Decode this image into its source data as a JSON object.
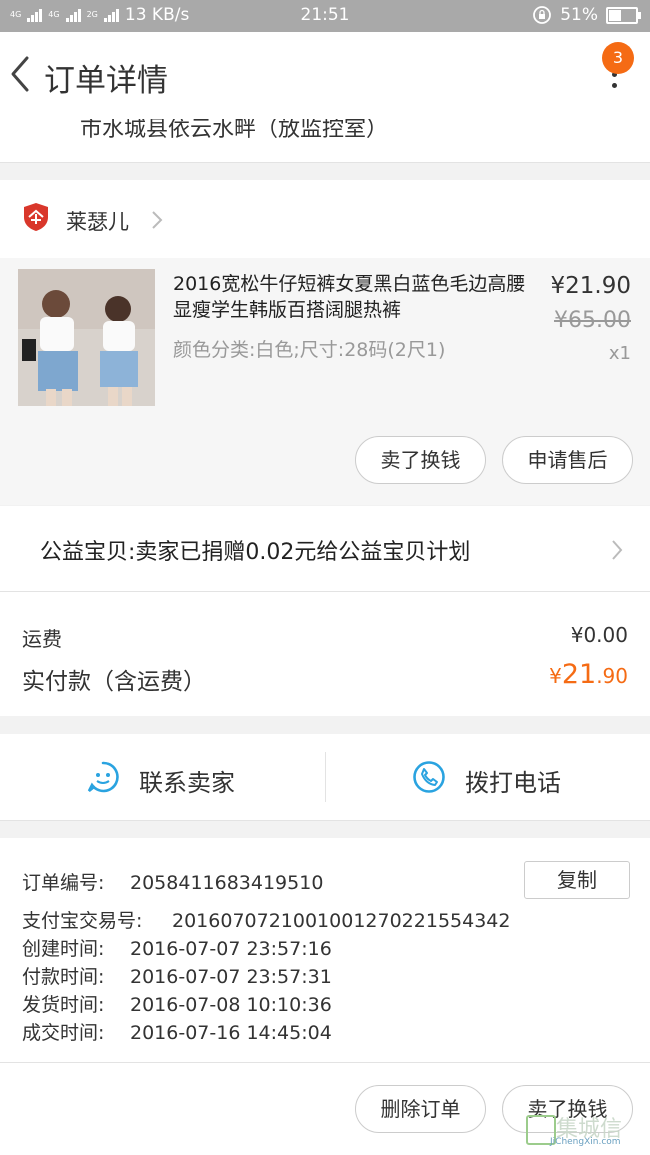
{
  "status_bar": {
    "network_left": "4G",
    "network_mid": "4G",
    "network_2g": "2G",
    "speed": "13 KB/s",
    "time": "21:51",
    "battery": "51%"
  },
  "header": {
    "title": "订单详情",
    "badge_count": "3"
  },
  "address_tail": "市水城县依云水畔（放监控室）",
  "seller": {
    "name": "莱瑟儿"
  },
  "item": {
    "title": "2016宽松牛仔短裤女夏黑白蓝色毛边高腰显瘦学生韩版百搭阔腿热裤",
    "sku": "颜色分类:白色;尺寸:28码(2尺1)",
    "price": "¥21.90",
    "original_price": "¥65.00",
    "quantity": "x1",
    "actions": [
      "卖了换钱",
      "申请售后"
    ]
  },
  "charity": {
    "text": "公益宝贝:卖家已捐赠0.02元给公益宝贝计划"
  },
  "fees": {
    "shipping_label": "运费",
    "shipping_value": "¥0.00",
    "paid_label": "实付款（含运费）",
    "paid_currency": "¥",
    "paid_integer": "21",
    "paid_decimal": ".90"
  },
  "contact": {
    "seller_label": "联系卖家",
    "phone_label": "拨打电话"
  },
  "order_info": {
    "copy_label": "复制",
    "rows": [
      {
        "key": "订单编号:",
        "value": "2058411683419510"
      },
      {
        "key": "支付宝交易号:",
        "value": "2016070721001001270221554342"
      },
      {
        "key": "创建时间:",
        "value": "2016-07-07 23:57:16"
      },
      {
        "key": "付款时间:",
        "value": "2016-07-07 23:57:31"
      },
      {
        "key": "发货时间:",
        "value": "2016-07-08 10:10:36"
      },
      {
        "key": "成交时间:",
        "value": "2016-07-16 14:45:04"
      }
    ]
  },
  "bottom_actions": [
    "删除订单",
    "卖了换钱"
  ],
  "watermark": {
    "text": "集城信",
    "sub": "JiChengXin.com"
  },
  "colors": {
    "accent": "#f56b14",
    "icon_blue": "#2aa3e0",
    "seller_red": "#d9372b"
  }
}
